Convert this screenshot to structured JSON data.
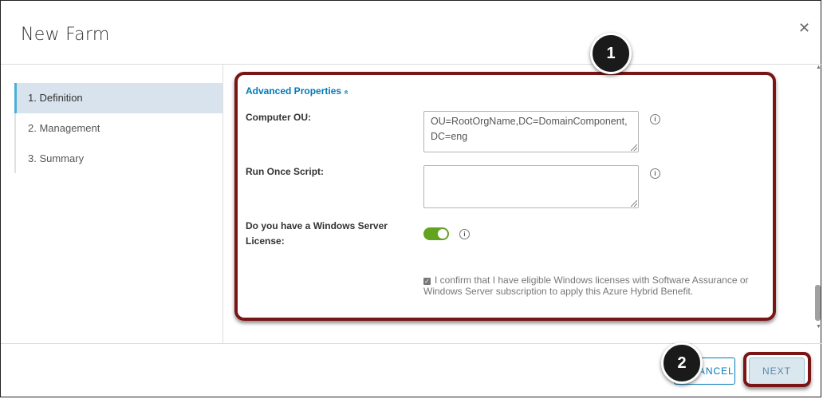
{
  "dialog": {
    "title": "New Farm",
    "close_icon": "close-icon"
  },
  "sidebar": {
    "items": [
      {
        "label": "1. Definition",
        "active": true
      },
      {
        "label": "2. Management",
        "active": false
      },
      {
        "label": "3. Summary",
        "active": false
      }
    ]
  },
  "form": {
    "advanced_label": "Advanced Properties",
    "advanced_chevron": "»",
    "computer_ou_label": "Computer OU:",
    "computer_ou_value": "OU=RootOrgName,DC=DomainComponent,DC=eng",
    "run_once_label": "Run Once Script:",
    "run_once_value": "",
    "license_label": "Do you have a Windows Server License:",
    "license_toggle_on": true,
    "confirm_checked": true,
    "confirm_text": "I confirm that I have eligible Windows licenses with Software Assurance or Windows Server subscription to apply this Azure Hybrid Benefit.",
    "info_glyph": "i"
  },
  "footer": {
    "cancel_label": "CANCEL",
    "cancel_visible_label": "NCEL",
    "next_label": "NEXT"
  },
  "callouts": {
    "one": "1",
    "two": "2"
  },
  "colors": {
    "accent": "#0079b8",
    "callout": "#7a1516",
    "toggle_on": "#62a420",
    "active_nav": "#d8e3ed"
  }
}
